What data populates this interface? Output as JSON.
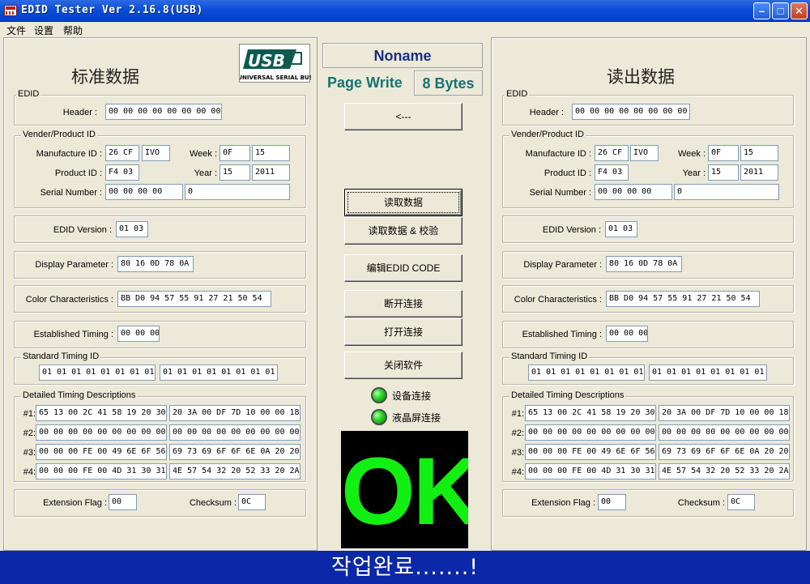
{
  "window": {
    "title": "EDID Tester Ver 2.16.8(USB)"
  },
  "menu": [
    "文件",
    "设置",
    "帮助"
  ],
  "left": {
    "title": "标准数据",
    "edid_group": "EDID",
    "header_label": "Header :",
    "header": "00 00 00 00 00 00 00 00",
    "vendor_group": "Vender/Product ID",
    "manufacture_label": "Manufacture ID :",
    "manufacture_hex": "26 CF",
    "manufacture_code": "IVO",
    "week_label": "Week :",
    "week_hex": "0F",
    "week": "15",
    "product_label": "Product ID :",
    "product": "F4 03",
    "year_label": "Year :",
    "year_hex": "15",
    "year": "2011",
    "serial_label": "Serial Number :",
    "serial_hex": "00 00 00 00",
    "serial": "0",
    "version_label": "EDID Version :",
    "version": "01 03",
    "display_label": "Display Parameter :",
    "display": "80 16 0D 78 0A",
    "color_label": "Color Characteristics :",
    "color": "BB D0 94 57 55 91 27 21 50 54",
    "established_label": "Established Timing :",
    "established": "00 00 00",
    "standard_group": "Standard Timing ID",
    "standard1": "01 01 01 01 01 01 01 01",
    "standard2": "01 01 01 01 01 01 01 01",
    "detailed_group": "Detailed Timing Descriptions",
    "d_labels": [
      "#1:",
      "#2:",
      "#3:",
      "#4:"
    ],
    "d1a": "65 13 00 2C 41 58 19 20 30",
    "d1b": "20 3A 00 DF 7D 10 00 00 18",
    "d2a": "00 00 00 00 00 00 00 00 00",
    "d2b": "00 00 00 00 00 00 00 00 00",
    "d3a": "00 00 00 FE 00 49 6E 6F 56",
    "d3b": "69 73 69 6F 6F 6E 0A 20 20",
    "d4a": "00 00 00 FE 00 4D 31 30 31",
    "d4b": "4E 57 54 32 20 52 33 20 2A",
    "ext_label": "Extension Flag :",
    "ext": "00",
    "checksum_label": "Checksum :",
    "checksum": "0C"
  },
  "right": {
    "title": "读出数据",
    "edid_group": "EDID",
    "header_label": "Header :",
    "header": "00 00 00 00 00 00 00 00",
    "vendor_group": "Vender/Product ID",
    "manufacture_label": "Manufacture ID :",
    "manufacture_hex": "26 CF",
    "manufacture_code": "IVO",
    "week_label": "Week :",
    "week_hex": "0F",
    "week": "15",
    "product_label": "Product ID :",
    "product": "F4 03",
    "year_label": "Year :",
    "year_hex": "15",
    "year": "2011",
    "serial_label": "Serial Number :",
    "serial_hex": "00 00 00 00",
    "serial": "0",
    "version_label": "EDID Version :",
    "version": "01 03",
    "display_label": "Display Parameter :",
    "display": "80 16 0D 78 0A",
    "color_label": "Color Characteristics :",
    "color": "BB D0 94 57 55 91 27 21 50 54",
    "established_label": "Established Timing :",
    "established": "00 00 00",
    "standard_group": "Standard Timing ID",
    "standard1": "01 01 01 01 01 01 01 01",
    "standard2": "01 01 01 01 01 01 01 01",
    "detailed_group": "Detailed Timing Descriptions",
    "d_labels": [
      "#1:",
      "#2:",
      "#3:",
      "#4:"
    ],
    "d1a": "65 13 00 2C 41 58 19 20 30",
    "d1b": "20 3A 00 DF 7D 10 00 00 18",
    "d2a": "00 00 00 00 00 00 00 00 00",
    "d2b": "00 00 00 00 00 00 00 00 00",
    "d3a": "00 00 00 FE 00 49 6E 6F 56",
    "d3b": "69 73 69 6F 6F 6E 0A 20 20",
    "d4a": "00 00 00 FE 00 4D 31 30 31",
    "d4b": "4E 57 54 32 20 52 33 20 2A",
    "ext_label": "Extension Flag :",
    "ext": "00",
    "checksum_label": "Checksum :",
    "checksum": "0C"
  },
  "center": {
    "model": "Noname",
    "mode": "Page Write",
    "bytes": "8 Bytes",
    "copy_button": "<---",
    "buttons": [
      "读取数据",
      "读取数据 & 校验",
      "编辑EDID CODE",
      "断开连接",
      "打开连接",
      "关闭软件"
    ],
    "led1_label": "设备连接",
    "led2_label": "液晶屏连接",
    "result": "OK"
  },
  "logo": {
    "text": "USB",
    "subtext": "UNIVERSAL SERIAL BUS"
  },
  "status": "작업완료.......!"
}
